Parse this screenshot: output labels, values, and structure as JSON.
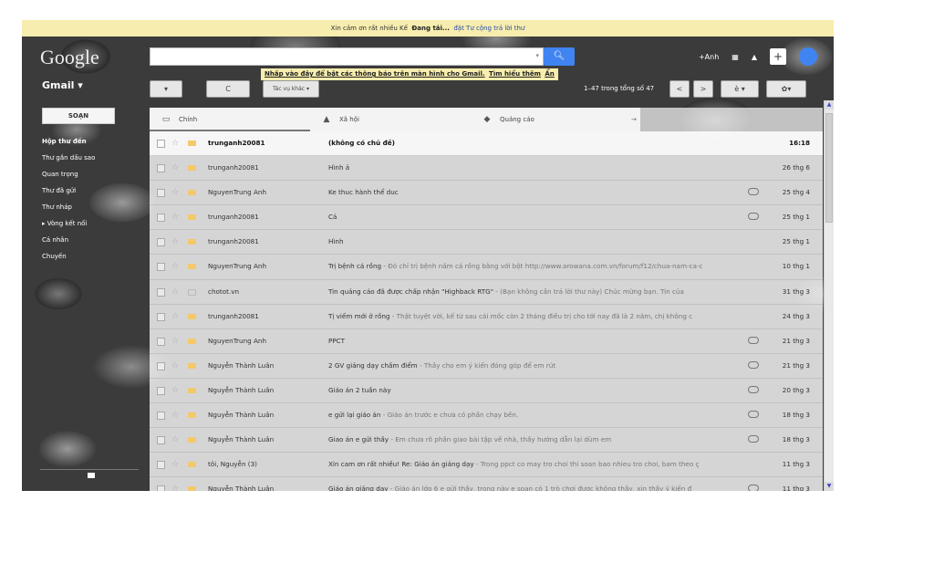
{
  "notice": {
    "text": "Xin cảm ơn rất nhiều Kế",
    "loading": "Đang tải...",
    "link": "đặt Tư cộng trả lời thư"
  },
  "header": {
    "logo": "Google",
    "user": "+Anh",
    "search": {
      "value": "",
      "placeholder": ""
    }
  },
  "tooltip": {
    "main": "Nhấp vào đây để bật các thông báo trên màn hình cho Gmail.",
    "learn": "Tìm hiểu thêm",
    "hide": "Ẩn"
  },
  "gmail_label": "Gmail ▾",
  "toolbar": {
    "select": "▾",
    "refresh": "C",
    "more": "Tác vụ khác ▾",
    "page_info": "1–47 trong tổng số 47",
    "prev": "<",
    "next": ">",
    "lang": "è ▾",
    "settings": "✿▾"
  },
  "sidebar": {
    "compose": "SOẠN",
    "items": [
      {
        "label": "Hộp thư đến"
      },
      {
        "label": "Thư gắn dấu sao"
      },
      {
        "label": "Quan trọng"
      },
      {
        "label": "Thư đã gửi"
      },
      {
        "label": "Thư nháp"
      },
      {
        "label": "▸ Vòng kết nối"
      },
      {
        "label": "Cá nhân"
      },
      {
        "label": "Chuyến"
      }
    ]
  },
  "tabs": [
    {
      "label": "Chính",
      "icon": "inbox-icon"
    },
    {
      "label": "Xã hội",
      "icon": "people-icon"
    },
    {
      "label": "Quảng cáo",
      "icon": "tag-icon"
    }
  ],
  "emails": [
    {
      "sender": "trunganh20081",
      "subject": "(không có chủ đề)",
      "snippet": "",
      "date": "16:18",
      "unread": true,
      "attach": false,
      "important": true
    },
    {
      "sender": "trunganh20081",
      "subject": "Hình ả",
      "snippet": "",
      "date": "26 thg 6",
      "unread": false,
      "attach": false,
      "important": true
    },
    {
      "sender": "NguyenTrung Anh",
      "subject": "Ke thuc hành thể duc",
      "snippet": "",
      "date": "25 thg 4",
      "unread": false,
      "attach": true,
      "important": true
    },
    {
      "sender": "trunganh20081",
      "subject": "Cá",
      "snippet": "",
      "date": "25 thg 1",
      "unread": false,
      "attach": true,
      "important": true
    },
    {
      "sender": "trunganh20081",
      "subject": "Hình",
      "snippet": "",
      "date": "25 thg 1",
      "unread": false,
      "attach": false,
      "important": true
    },
    {
      "sender": "NguyenTrung Anh",
      "subject": "Trị bệnh cá rồng",
      "snippet": " - Đó chỉ trị bệnh nấm cá rồng bằng với bột http://www.arowana.com.vn/forum/f12/chua-nam-ca-c",
      "date": "10 thg 1",
      "unread": false,
      "attach": false,
      "important": true
    },
    {
      "sender": "chotot.vn",
      "subject": "Tin quảng cáo đã được chấp nhận \"Highback RTG\"",
      "snippet": " - (Bạn không cần trả lời thư này) Chúc mừng bạn. Tin của",
      "date": "31 thg 3",
      "unread": false,
      "attach": false,
      "important": false
    },
    {
      "sender": "trunganh20081",
      "subject": "Tị viếm mới ở rồng",
      "snippet": " - Thật tuyệt vời, kế từ sau cái mốc còn 2 tháng điều trị cho tới nay đã là 2 năm, chị không c",
      "date": "24 thg 3",
      "unread": false,
      "attach": false,
      "important": true
    },
    {
      "sender": "NguyenTrung Anh",
      "subject": "PPCT",
      "snippet": "",
      "date": "21 thg 3",
      "unread": false,
      "attach": true,
      "important": true
    },
    {
      "sender": "Nguyễn Thành Luân",
      "subject": "2 GV giảng dạy chấm điểm",
      "snippet": " - Thầy cho em ý kiến đóng góp để em rút",
      "date": "21 thg 3",
      "unread": false,
      "attach": true,
      "important": true
    },
    {
      "sender": "Nguyễn Thành Luân",
      "subject": "Giáo án 2 tuần này",
      "snippet": "",
      "date": "20 thg 3",
      "unread": false,
      "attach": true,
      "important": true
    },
    {
      "sender": "Nguyễn Thành Luân",
      "subject": "e gửi lại giáo án",
      "snippet": " - Giáo án trước e chưa có phần chạy bền.",
      "date": "18 thg 3",
      "unread": false,
      "attach": true,
      "important": true
    },
    {
      "sender": "Nguyễn Thành Luân",
      "subject": "Giao án e gửi thầy",
      "snippet": " - Em chưa rõ phần giao bài tập về nhà, thầy hướng dẫn lại dùm em",
      "date": "18 thg 3",
      "unread": false,
      "attach": true,
      "important": true
    },
    {
      "sender": "tôi, Nguyễn (3)",
      "subject": "Xin cam ơn rất nhiều! Re: Giáo án giảng dạy",
      "snippet": " - Trong ppct co may tro choi thi soan bao nhieu tro choi, bam theo ç",
      "date": "11 thg 3",
      "unread": false,
      "attach": false,
      "important": true
    },
    {
      "sender": "Nguyễn Thành Luân",
      "subject": "Giáo án giảng dạy",
      "snippet": " - Giáo án lớp 6 e gửi thầy, trong này e soạn có 1 trò chơi được không thầy, xin thầy ý kiến đ",
      "date": "11 thg 3",
      "unread": false,
      "attach": true,
      "important": true
    }
  ],
  "colors": {
    "accent": "#3f84f1",
    "notice_bg": "#f7edae",
    "important": "#f3c96b"
  }
}
